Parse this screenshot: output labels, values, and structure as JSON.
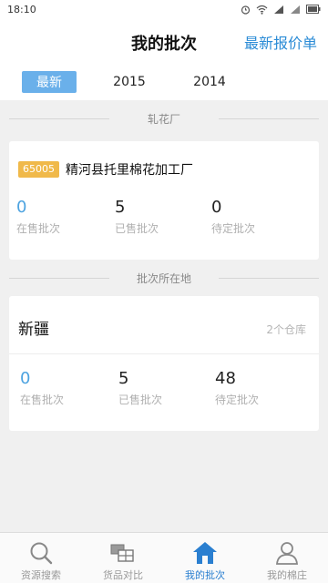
{
  "status_bar": {
    "time": "18:10"
  },
  "header": {
    "title": "我的批次",
    "action_label": "最新报价单"
  },
  "year_tabs": [
    {
      "label": "最新",
      "active": true
    },
    {
      "label": "2015",
      "active": false
    },
    {
      "label": "2014",
      "active": false
    }
  ],
  "ginnery_section": {
    "label": "轧花厂",
    "code": "65005",
    "name": "精河县托里棉花加工厂",
    "stats": [
      {
        "value": "0",
        "label": "在售批次"
      },
      {
        "value": "5",
        "label": "已售批次"
      },
      {
        "value": "0",
        "label": "待定批次"
      }
    ]
  },
  "region_section": {
    "label": "批次所在地",
    "region": "新疆",
    "warehouse_count": "2个仓库",
    "stats": [
      {
        "value": "0",
        "label": "在售批次"
      },
      {
        "value": "5",
        "label": "已售批次"
      },
      {
        "value": "48",
        "label": "待定批次"
      }
    ]
  },
  "bottom_nav": [
    {
      "label": "资源搜索",
      "icon": "search-icon",
      "active": false
    },
    {
      "label": "货品对比",
      "icon": "compare-icon",
      "active": false
    },
    {
      "label": "我的批次",
      "icon": "home-icon",
      "active": true
    },
    {
      "label": "我的棉庄",
      "icon": "person-icon",
      "active": false
    }
  ],
  "colors": {
    "accent": "#2a8bd6",
    "tab_active": "#6ab0ea",
    "badge": "#f0b94a",
    "stat_blue": "#4da3e0"
  }
}
